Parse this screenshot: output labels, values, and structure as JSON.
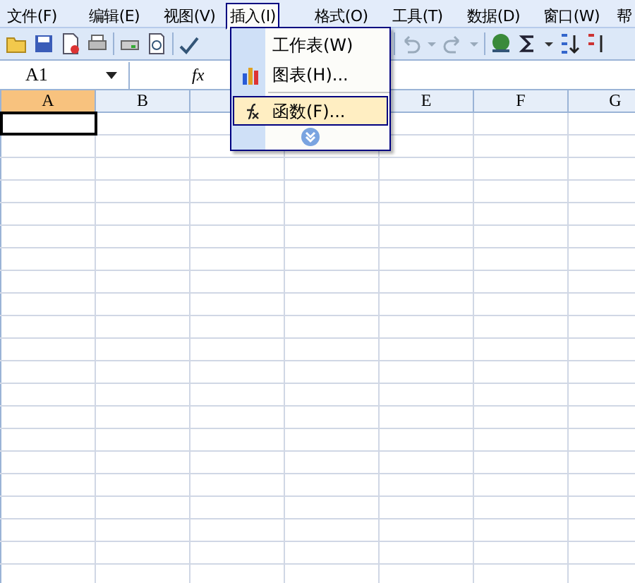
{
  "menu_bar": [
    {
      "label": "文件(F)",
      "selected": false
    },
    {
      "label": "编辑(E)",
      "selected": false
    },
    {
      "label": "视图(V)",
      "selected": false
    },
    {
      "label": "插入(I)",
      "selected": true
    },
    {
      "label": "格式(O)",
      "selected": false
    },
    {
      "label": "工具(T)",
      "selected": false
    },
    {
      "label": "数据(D)",
      "selected": false
    },
    {
      "label": "窗口(W)",
      "selected": false
    },
    {
      "label": "帮",
      "selected": false
    }
  ],
  "insert_menu": {
    "items": [
      {
        "label": "工作表(W)",
        "kind": "item",
        "selected": false
      },
      {
        "label": "图表(H)...",
        "kind": "chart",
        "selected": false
      },
      {
        "kind": "separator"
      },
      {
        "label": "函数(F)...",
        "kind": "function",
        "selected": true
      },
      {
        "kind": "expand"
      }
    ]
  },
  "formula_bar": {
    "name_box": "A1",
    "fx": "fx"
  },
  "sheet": {
    "columns": [
      {
        "label": "A",
        "selected": true
      },
      {
        "label": "B",
        "selected": false
      }
    ],
    "columns_right_of_menu": [
      {
        "label": "E",
        "selected": false
      },
      {
        "label": "F",
        "selected": false
      },
      {
        "label": "G",
        "selected": false
      }
    ]
  }
}
